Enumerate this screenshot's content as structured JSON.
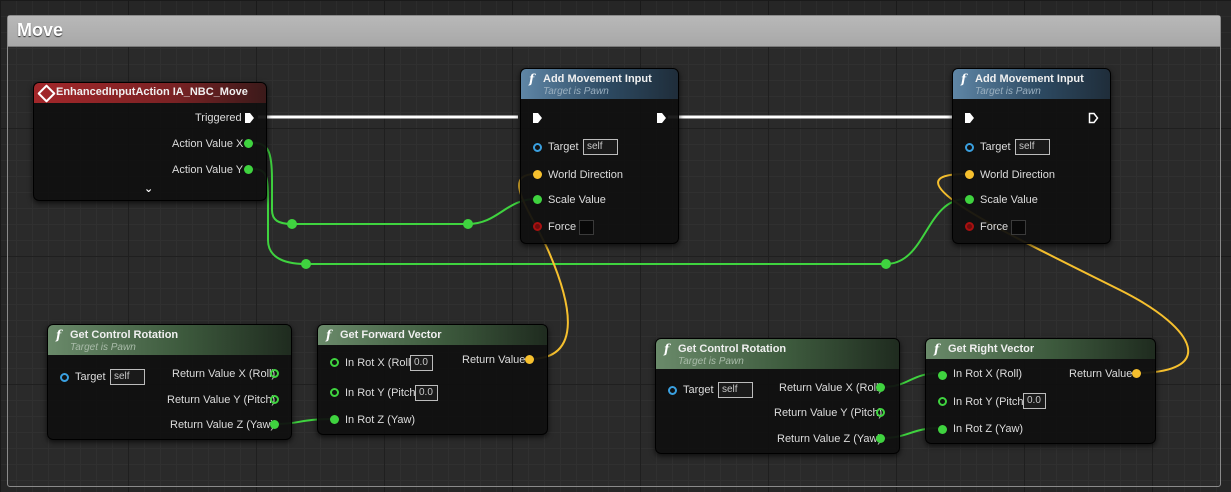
{
  "comment": {
    "title": "Move"
  },
  "colors": {
    "exec": "#ffffff",
    "float": "#3fd33f",
    "vector": "#f6c02e",
    "object": "#3aa0e0",
    "bool": "#a81010",
    "event_header": "#a3272a",
    "func_header": "#5f86a6",
    "pure_header": "#6a8a6a"
  },
  "event_node": {
    "title": "EnhancedInputAction IA_NBC_Move",
    "icon": "event-diamond-icon",
    "pins": {
      "triggered": "Triggered",
      "action_x": "Action Value X",
      "action_y": "Action Value Y"
    },
    "expand_icon": "chevron-down-icon"
  },
  "add_movement_1": {
    "title": "Add Movement Input",
    "subtitle": "Target is Pawn",
    "pins": {
      "target": "Target",
      "target_value": "self",
      "world_direction": "World Direction",
      "scale_value": "Scale Value",
      "force": "Force"
    }
  },
  "add_movement_2": {
    "title": "Add Movement Input",
    "subtitle": "Target is Pawn",
    "pins": {
      "target": "Target",
      "target_value": "self",
      "world_direction": "World Direction",
      "scale_value": "Scale Value",
      "force": "Force"
    }
  },
  "get_control_rotation_1": {
    "title": "Get Control Rotation",
    "subtitle": "Target is Pawn",
    "pins": {
      "target": "Target",
      "target_value": "self",
      "ret_x": "Return Value X (Roll)",
      "ret_y": "Return Value Y (Pitch)",
      "ret_z": "Return Value Z (Yaw)"
    }
  },
  "get_forward_vector": {
    "title": "Get Forward Vector",
    "pins": {
      "in_x": "In Rot X (Roll)",
      "in_x_value": "0.0",
      "in_y": "In Rot Y (Pitch)",
      "in_y_value": "0.0",
      "in_z": "In Rot Z (Yaw)",
      "return_value": "Return Value"
    }
  },
  "get_control_rotation_2": {
    "title": "Get Control Rotation",
    "subtitle": "Target is Pawn",
    "pins": {
      "target": "Target",
      "target_value": "self",
      "ret_x": "Return Value X (Roll)",
      "ret_y": "Return Value Y (Pitch)",
      "ret_z": "Return Value Z (Yaw)"
    }
  },
  "get_right_vector": {
    "title": "Get Right Vector",
    "pins": {
      "in_x": "In Rot X (Roll)",
      "in_y": "In Rot Y (Pitch)",
      "in_y_value": "0.0",
      "in_z": "In Rot Z (Yaw)",
      "return_value": "Return Value"
    }
  }
}
